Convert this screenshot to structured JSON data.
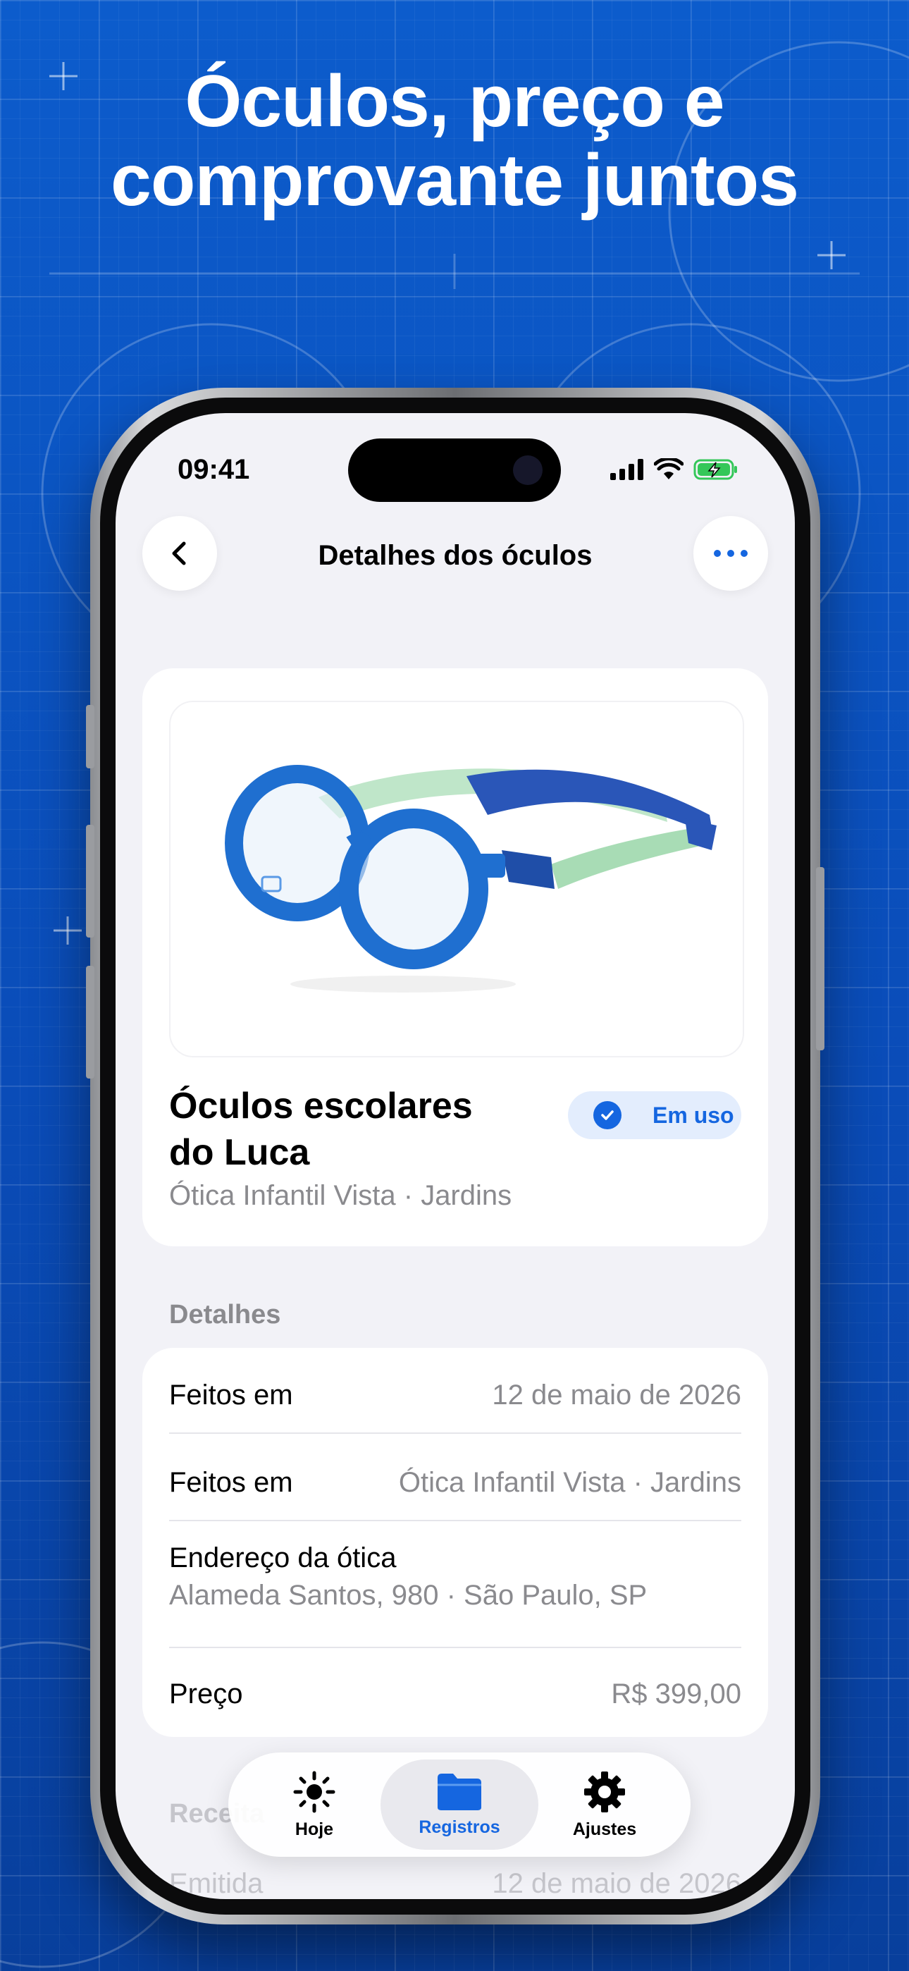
{
  "headline": {
    "line1": "Óculos, preço e",
    "line2": "comprovante juntos"
  },
  "status_bar": {
    "time": "09:41"
  },
  "nav": {
    "title": "Detalhes dos óculos",
    "back_icon": "chevron-left-icon",
    "more_icon": "ellipsis-icon"
  },
  "glasses": {
    "title_line1": "Óculos escolares",
    "title_line2": "do Luca",
    "store": "Ótica Infantil Vista · Jardins",
    "status_badge": "Em uso"
  },
  "details": {
    "section_title": "Detalhes",
    "rows": [
      {
        "label": "Feitos em",
        "value": "12 de maio de 2026"
      },
      {
        "label": "Feitos em",
        "value": "Ótica Infantil Vista · Jardins"
      },
      {
        "label": "Endereço da ótica",
        "value": "Alameda Santos, 980 · São Paulo, SP"
      },
      {
        "label": "Preço",
        "value": "R$ 399,00"
      }
    ]
  },
  "receipt": {
    "section_title": "Receita",
    "issued_label": "Emitida",
    "issued_value": "12 de maio de 2026"
  },
  "tabbar": {
    "tabs": [
      {
        "label": "Hoje",
        "icon": "sun-icon",
        "active": false
      },
      {
        "label": "Registros",
        "icon": "folder-icon",
        "active": true
      },
      {
        "label": "Ajustes",
        "icon": "gear-icon",
        "active": false
      }
    ]
  },
  "colors": {
    "accent": "#1566e0",
    "background": "#0a52c4",
    "badge_bg": "#e3edfd"
  }
}
